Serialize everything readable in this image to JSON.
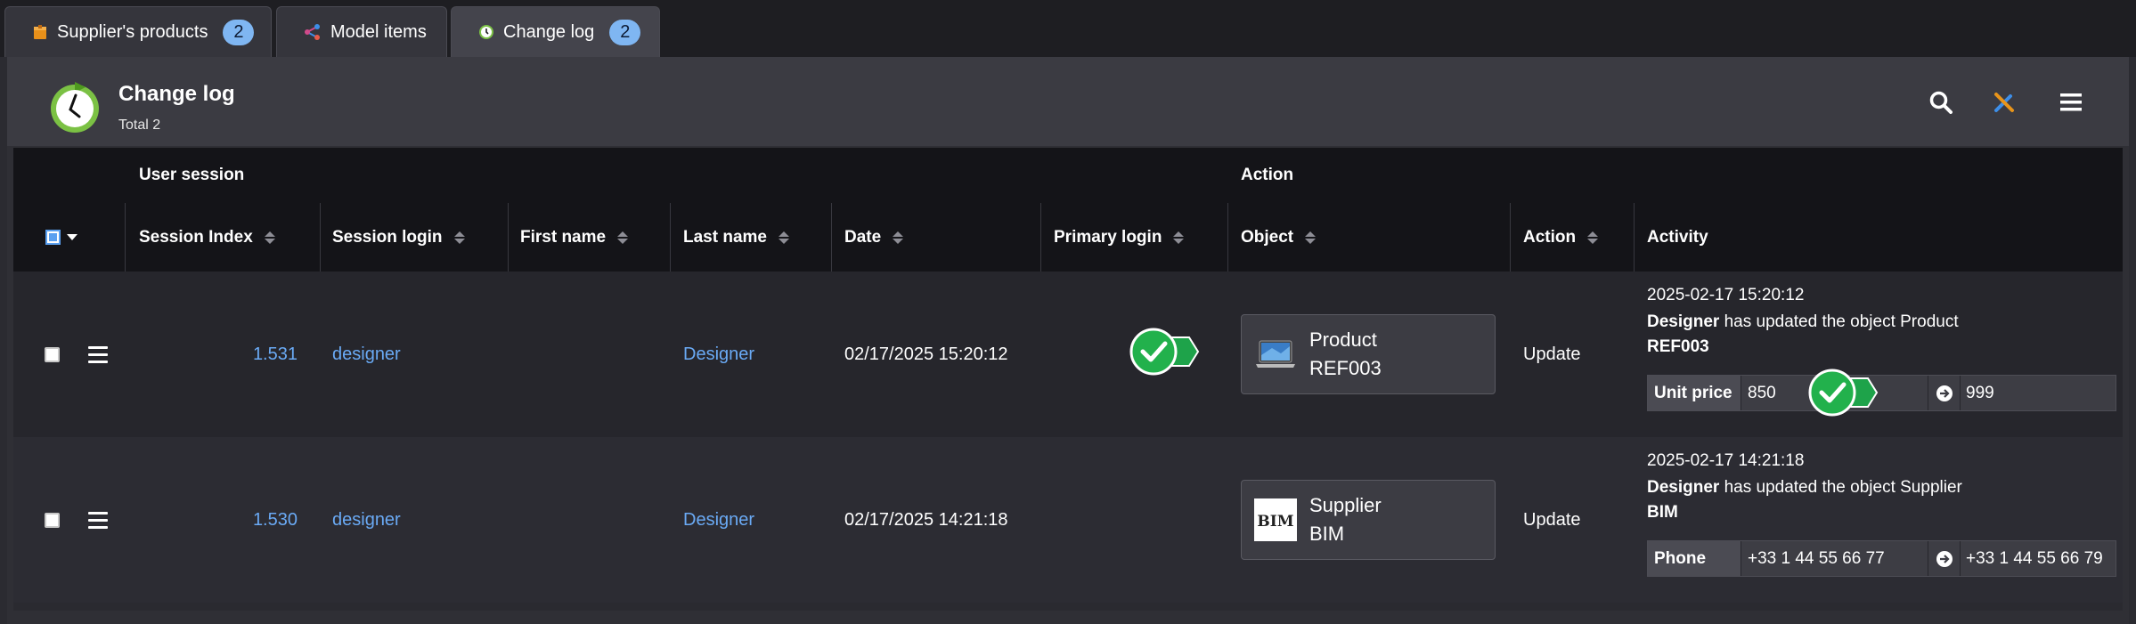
{
  "tabs": [
    {
      "label": "Supplier's products",
      "badge": "2",
      "icon": "package-icon"
    },
    {
      "label": "Model items",
      "icon": "share-nodes-icon"
    },
    {
      "label": "Change log",
      "badge": "2",
      "icon": "clock-icon",
      "active": true
    }
  ],
  "header": {
    "title": "Change log",
    "subtitle": "Total 2"
  },
  "toolbar": {
    "icons": [
      "search-icon",
      "tools-icon",
      "menu-icon"
    ]
  },
  "grid": {
    "groups": {
      "user_session": "User session",
      "action": "Action"
    },
    "columns": {
      "session_index": "Session Index",
      "session_login": "Session login",
      "first_name": "First name",
      "last_name": "Last name",
      "date": "Date",
      "primary_login": "Primary login",
      "object": "Object",
      "action": "Action",
      "activity": "Activity"
    },
    "rows": [
      {
        "session_index": "1.531",
        "session_login": "designer",
        "first_name": "",
        "last_name": "Designer",
        "date": "02/17/2025 15:20:12",
        "primary_login": true,
        "object": {
          "type": "Product",
          "ref": "REF003",
          "thumb": "laptop-icon"
        },
        "action": "Update",
        "activity": {
          "timestamp": "2025-02-17 15:20:12",
          "actor": "Designer",
          "text": " has updated the object Product",
          "ref": "REF003",
          "field": "Unit price",
          "old": "850",
          "new": "999"
        }
      },
      {
        "session_index": "1.530",
        "session_login": "designer",
        "first_name": "",
        "last_name": "Designer",
        "date": "02/17/2025 14:21:18",
        "primary_login": false,
        "object": {
          "type": "Supplier",
          "ref": "BIM",
          "thumb": "bim-logo"
        },
        "action": "Update",
        "activity": {
          "timestamp": "2025-02-17 14:21:18",
          "actor": "Designer",
          "text": " has updated the object Supplier",
          "ref": "BIM",
          "field": "Phone",
          "old": "+33 1 44 55 66 77",
          "new": "+33 1 44 55 66 79"
        }
      }
    ]
  },
  "colors": {
    "accent_link": "#6aaaf5",
    "badge": "#7fb6f2",
    "success": "#22b14c"
  }
}
